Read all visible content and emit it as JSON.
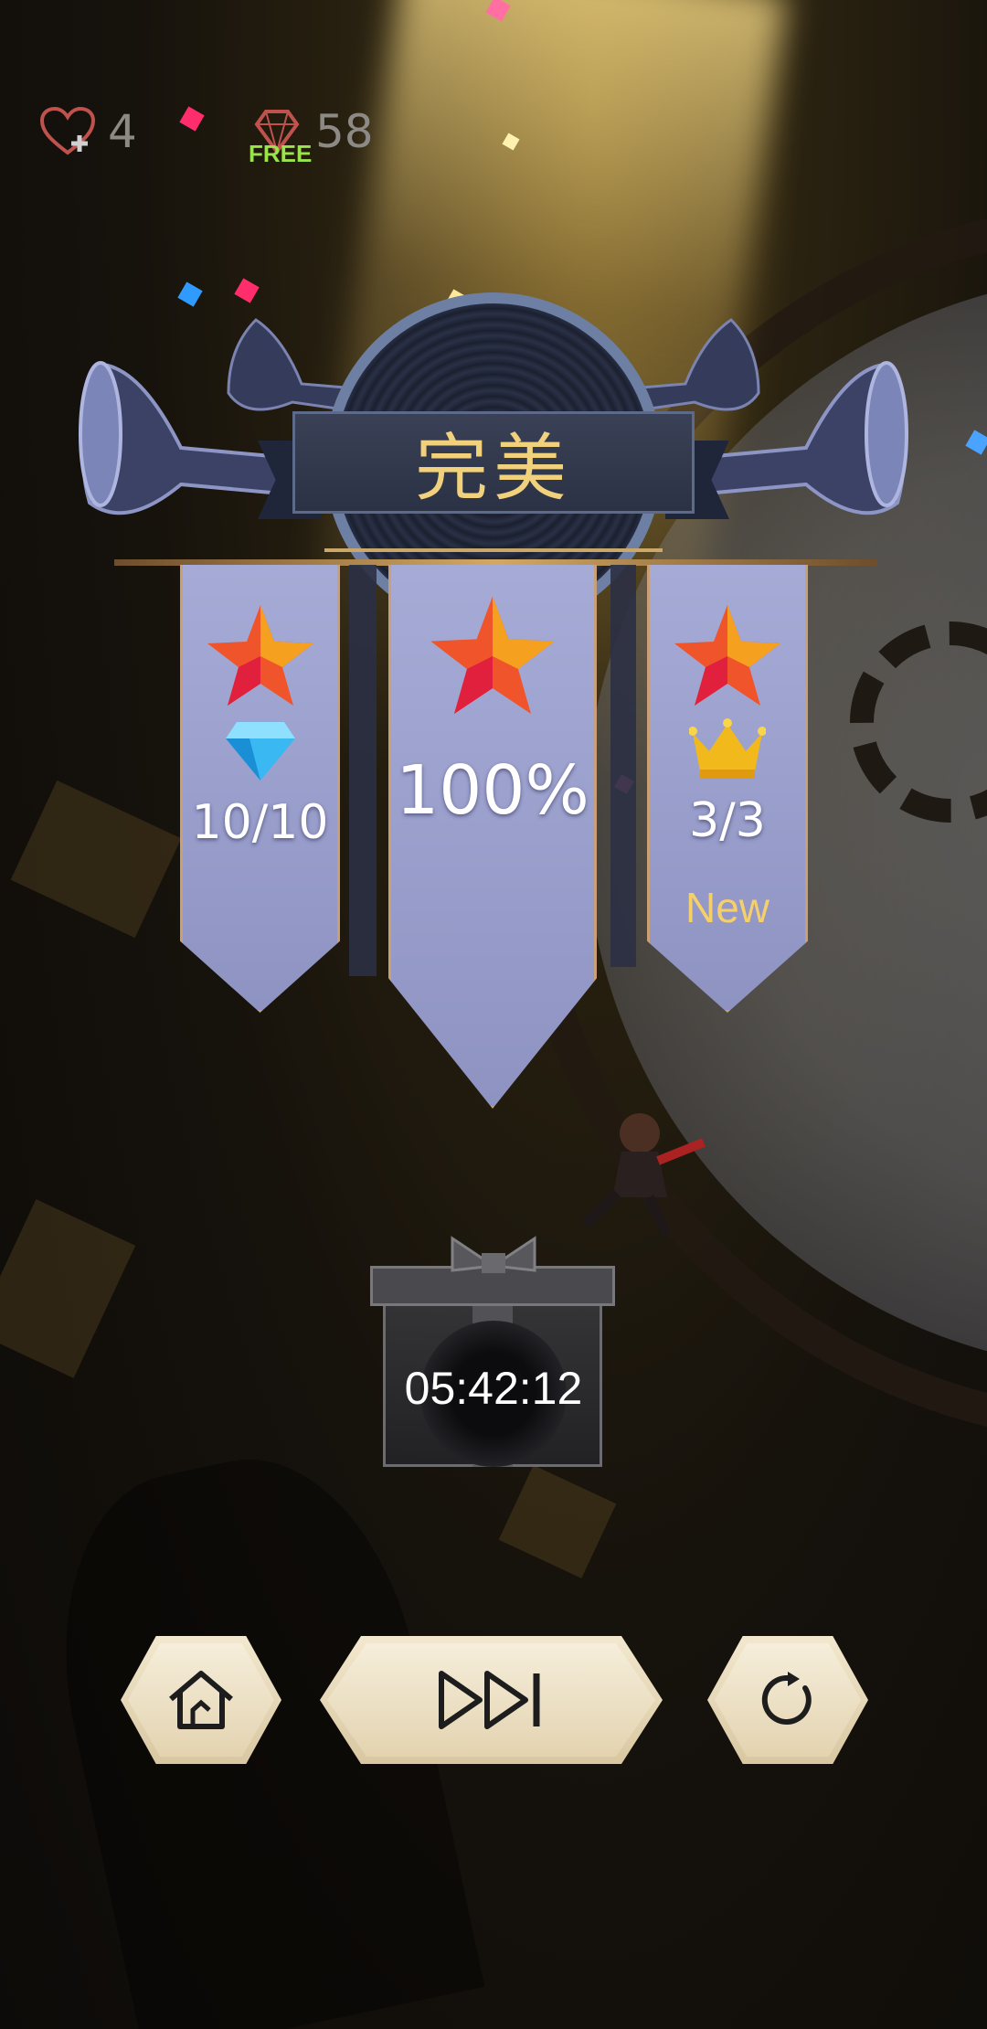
{
  "hud": {
    "lives": "4",
    "gems": "58",
    "free_tag": "FREE"
  },
  "result": {
    "title": "完美"
  },
  "stats": {
    "diamonds": "10/10",
    "percent": "100%",
    "crowns": "3/3",
    "new_label": "New"
  },
  "chest": {
    "timer": "05:42:12"
  },
  "buttons": {
    "home_icon": "home-icon",
    "next_icon": "next-icon",
    "retry_icon": "retry-icon"
  },
  "colors": {
    "title_text": "#f1d17c",
    "pennant": "#9ea3d0",
    "pennant_border": "#c89f76",
    "star": "#f0542a",
    "diamond": "#3ab8f2",
    "crown": "#f2b91c",
    "new_text": "#f5cf6a",
    "button": "#e6d8b8"
  }
}
